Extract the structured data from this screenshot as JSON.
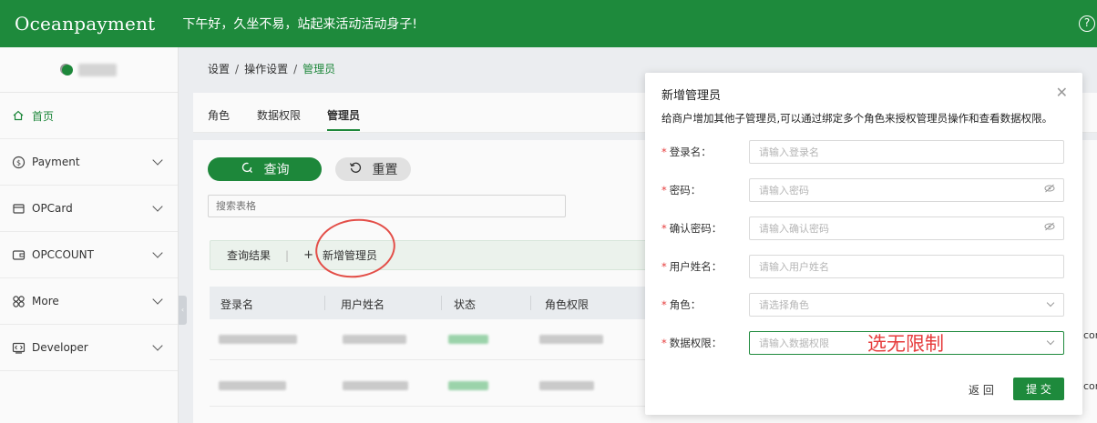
{
  "topbar": {
    "logo": "Oceanpayment",
    "greeting": "下午好，久坐不易，站起来活动活动身子!",
    "help_icon": "?"
  },
  "sidebar": {
    "items": [
      {
        "label": "首页",
        "icon": "home-icon",
        "active": true
      },
      {
        "label": "Payment",
        "icon": "payment-icon"
      },
      {
        "label": "OPCard",
        "icon": "card-icon"
      },
      {
        "label": "OPCCOUNT",
        "icon": "wallet-icon"
      },
      {
        "label": "More",
        "icon": "grid-icon"
      },
      {
        "label": "Developer",
        "icon": "code-icon"
      }
    ]
  },
  "breadcrumb": {
    "items": [
      "设置",
      "操作设置",
      "管理员"
    ],
    "separator": "/"
  },
  "tabs": [
    {
      "label": "角色"
    },
    {
      "label": "数据权限"
    },
    {
      "label": "管理员",
      "active": true
    }
  ],
  "toolbar": {
    "query_label": "查询",
    "reset_label": "重置",
    "search_placeholder": "搜索表格"
  },
  "results": {
    "label": "查询结果",
    "divider": "|",
    "add_label": "新增管理员"
  },
  "table": {
    "headers": [
      "登录名",
      "用户姓名",
      "状态",
      "角色权限"
    ]
  },
  "edge_text": [
    "con",
    "con"
  ],
  "modal": {
    "title": "新增管理员",
    "description": "给商户增加其他子管理员,可以通过绑定多个角色来授权管理员操作和查看数据权限。",
    "fields": [
      {
        "label": "登录名：",
        "placeholder": "请输入登录名",
        "type": "text"
      },
      {
        "label": "密码：",
        "placeholder": "请输入密码",
        "type": "password"
      },
      {
        "label": "确认密码：",
        "placeholder": "请输入确认密码",
        "type": "password"
      },
      {
        "label": "用户姓名：",
        "placeholder": "请输入用户姓名",
        "type": "text"
      },
      {
        "label": "角色：",
        "placeholder": "请选择角色",
        "type": "select"
      },
      {
        "label": "数据权限：",
        "placeholder": "请输入数据权限",
        "type": "select"
      }
    ],
    "annotation": "选无限制",
    "back_label": "返 回",
    "submit_label": "提 交"
  },
  "colors": {
    "brand": "#1e8a3c",
    "annotation_red": "#e63b3b"
  }
}
